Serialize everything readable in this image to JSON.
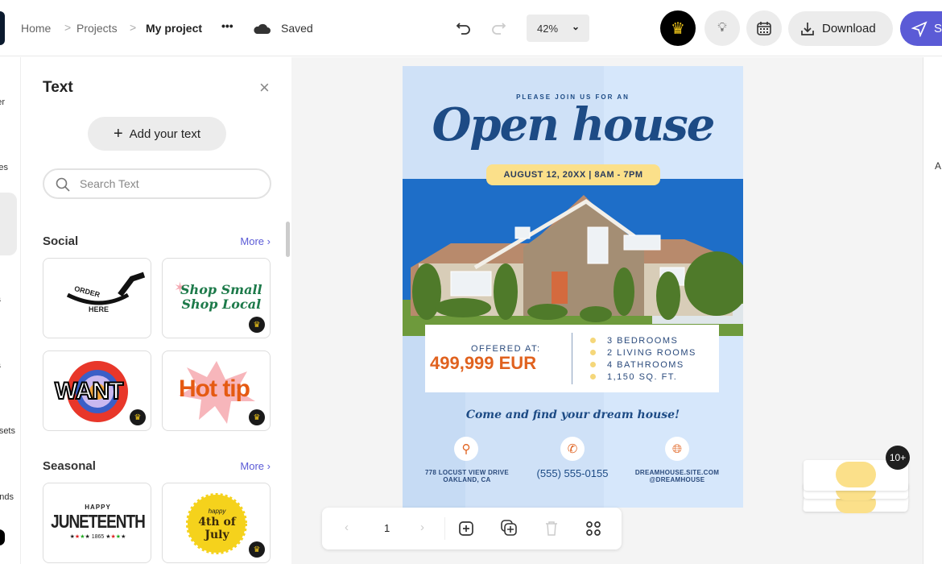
{
  "topbar": {
    "breadcrumb": [
      "Home",
      "Projects",
      "My project"
    ],
    "more": "•••",
    "status": "Saved",
    "zoom": "42%",
    "download": "Download",
    "share": "S",
    "crown_color": "#f2c81a",
    "share_color": "#5b5bd6"
  },
  "rail": {
    "labels": [
      "er",
      "es",
      "s",
      "s",
      "sets",
      "nds"
    ]
  },
  "panel": {
    "title": "Text",
    "add_text": "Add your text",
    "search_placeholder": "Search Text",
    "sections": [
      {
        "title": "Social",
        "more": "More"
      },
      {
        "title": "Seasonal",
        "more": "More"
      }
    ],
    "cards": {
      "order1": "ORDER",
      "order2": "HERE",
      "shop1": "Shop Small",
      "shop2": "Shop Local",
      "want": "WANT",
      "hottip": "Hot tip",
      "jun_happy": "HAPPY",
      "juneteenth": "JUNETEENTH",
      "jun_year": "1865",
      "july_happy": "happy",
      "july1": "4th of",
      "july2": "July"
    }
  },
  "flyer": {
    "kicker": "PLEASE JOIN US FOR AN",
    "title": "Open house",
    "date": "AUGUST 12, 20XX | 8AM - 7PM",
    "offered": "OFFERED AT:",
    "price": "499,999 EUR",
    "features": [
      "3 BEDROOMS",
      "2 LIVING ROOMS",
      "4 BATHROOMS",
      "1,150 SQ. FT."
    ],
    "tagline": "Come and find your dream house!",
    "address1": "778 LOCUST VIEW DRIVE",
    "address2": "OAKLAND, CA",
    "phone": "(555) 555-0155",
    "site1": "DREAMHOUSE.SITE.COM",
    "site2": "@DREAMHOUSE",
    "navy": "#1d4b85",
    "orange": "#e0621f",
    "yellow": "#fbe08a"
  },
  "pager": {
    "page": "1"
  },
  "stack": {
    "badge": "10+"
  },
  "right": {
    "label": "A"
  }
}
